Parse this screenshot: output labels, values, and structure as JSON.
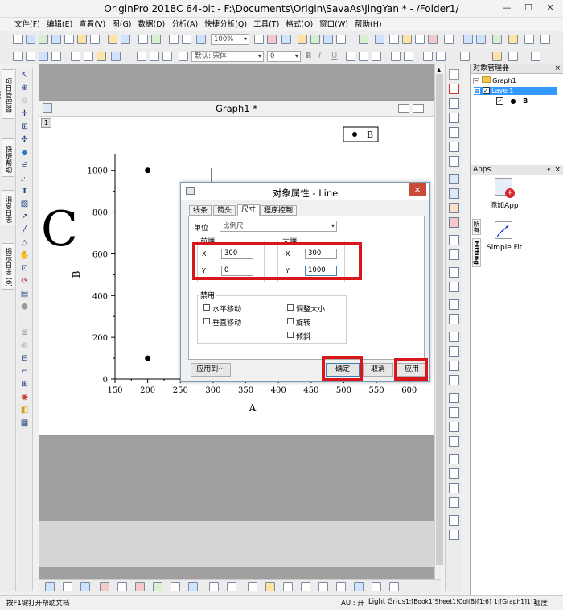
{
  "window": {
    "title": "OriginPro 2018C 64-bit - F:\\Documents\\Origin\\SavaAs\\JingYan * - /Folder1/"
  },
  "menu": [
    "文件(F)",
    "编辑(E)",
    "查看(V)",
    "图(G)",
    "数据(D)",
    "分析(A)",
    "快捷分析(Q)",
    "工具(T)",
    "格式(O)",
    "窗口(W)",
    "帮助(H)"
  ],
  "toolbar": {
    "zoom": "100%",
    "font": "默认: 宋体",
    "font_size": "0"
  },
  "left_tabs": [
    "项目管理器 (1)",
    "快捷帮助",
    "消息日志",
    "提示日志 (6)"
  ],
  "graph_window": {
    "title": "Graph1 *",
    "layer_number": "1"
  },
  "plot": {
    "legend_label": "B",
    "big_label": "C",
    "xlabel": "A",
    "ylabel": "B",
    "xticks": [
      "150",
      "200",
      "250",
      "300",
      "350",
      "400",
      "450",
      "500",
      "550",
      "600"
    ],
    "yticks": [
      "0",
      "200",
      "400",
      "600",
      "800",
      "1000"
    ]
  },
  "chart_data": {
    "type": "scatter",
    "x": [
      200,
      200
    ],
    "y": [
      1000,
      100
    ],
    "xlabel": "A",
    "ylabel": "B",
    "xlim": [
      150,
      620
    ],
    "ylim": [
      0,
      1080
    ],
    "series": [
      {
        "name": "B",
        "x": [
          200,
          200
        ],
        "y": [
          1000,
          100
        ]
      }
    ]
  },
  "dialog": {
    "title": "对象属性 - Line",
    "close_icon": "×",
    "tabs": [
      "线条",
      "箭头",
      "尺寸",
      "程序控制"
    ],
    "active_tab": "尺寸",
    "unit_label": "单位",
    "unit_value": "比例尺",
    "start_group": "前端",
    "end_group": "末端",
    "x_label": "X",
    "y_label": "Y",
    "start_x": "300",
    "start_y": "0",
    "end_x": "300",
    "end_y": "1000",
    "disable_group": "禁用",
    "checks": [
      "水平移动",
      "垂直移动",
      "调整大小",
      "旋转",
      "倾斜"
    ],
    "apply_to_button": "应用到···",
    "ok_button": "确定",
    "cancel_button": "取消",
    "apply_button": "应用"
  },
  "object_manager": {
    "title": "对象管理器",
    "graph": "Graph1",
    "layer": "Layer1",
    "plot": "B",
    "close_icon": "×"
  },
  "apps": {
    "title": "Apps",
    "items": [
      "添加App",
      "Simple Fit"
    ],
    "side_tabs": [
      "所有",
      "Fitting"
    ]
  },
  "statusbar": {
    "help": "按F1键打开帮助文档",
    "au": "AU : 开",
    "grids": "Light Grids",
    "ref": "1:[Book1]Sheet1!Col(B)[1:6]",
    "graph_ref": "1:[Graph1]1!1",
    "angle": "弧度"
  },
  "colors": {
    "highlight": "#d9161c",
    "selection": "#3399ff"
  }
}
